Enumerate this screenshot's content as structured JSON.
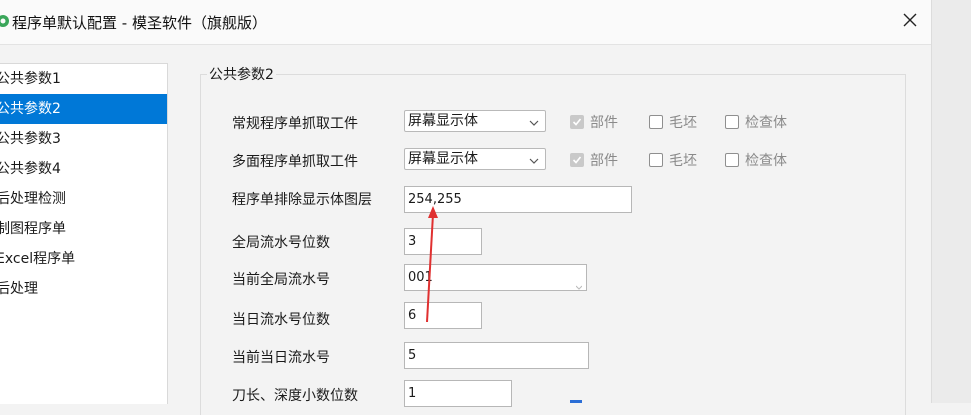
{
  "window": {
    "title": "程序单默认配置 - 模圣软件（旗舰版）"
  },
  "sidebar": {
    "items": [
      {
        "label": "公共参数1"
      },
      {
        "label": "公共参数2",
        "selected": true
      },
      {
        "label": "公共参数3"
      },
      {
        "label": "公共参数4"
      },
      {
        "label": "后处理检测"
      },
      {
        "label": "制图程序单"
      },
      {
        "label": "Excel程序单"
      },
      {
        "label": "后处理"
      }
    ]
  },
  "panel": {
    "title": "公共参数2",
    "rows": {
      "regular_grab": {
        "label": "常规程序单抓取工件",
        "select_value": "屏幕显示体",
        "checkboxes": [
          {
            "label": "部件",
            "checked": true
          },
          {
            "label": "毛坯",
            "checked": false
          },
          {
            "label": "检查体",
            "checked": false
          }
        ]
      },
      "multi_grab": {
        "label": "多面程序单抓取工件",
        "select_value": "屏幕显示体",
        "checkboxes": [
          {
            "label": "部件",
            "checked": true
          },
          {
            "label": "毛坯",
            "checked": false
          },
          {
            "label": "检查体",
            "checked": false
          }
        ]
      },
      "exclude_layers": {
        "label": "程序单排除显示体图层",
        "value": "254,255"
      },
      "global_serial_digits": {
        "label": "全局流水号位数",
        "value": "3"
      },
      "current_global_serial": {
        "label": "当前全局流水号",
        "value": "001"
      },
      "daily_serial_digits": {
        "label": "当日流水号位数",
        "value": "6"
      },
      "current_daily_serial": {
        "label": "当前当日流水号",
        "value": "5"
      },
      "tool_decimal_digits": {
        "label": "刀长、深度小数位数",
        "value": "1"
      }
    }
  },
  "colors": {
    "selection": "#0078d7",
    "annotation_arrow": "#e03030"
  },
  "icons": {
    "close": "close-icon",
    "dropdown": "chevron-down-icon",
    "app": "app-icon"
  }
}
